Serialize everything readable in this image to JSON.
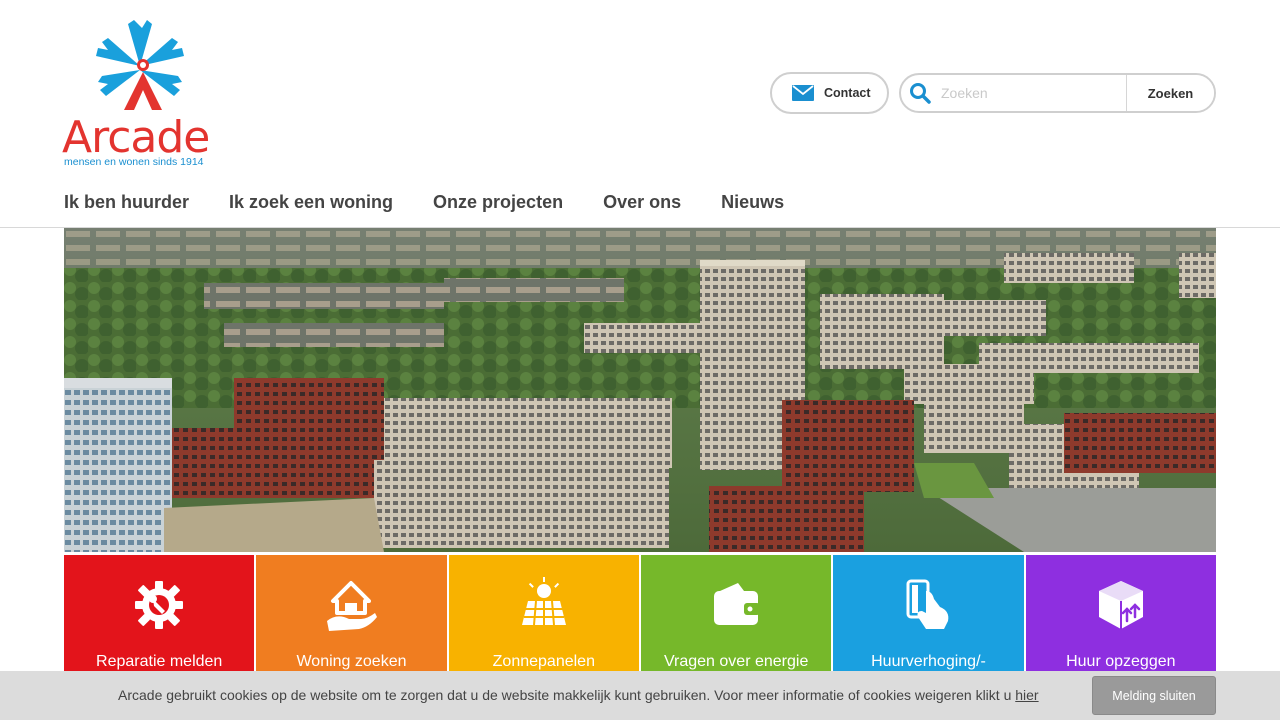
{
  "logo": {
    "word": "Arcade",
    "tagline": "mensen en wonen sinds 1914",
    "colors": {
      "figure_blue": "#1aa0dc",
      "figure_red": "#e3342f"
    }
  },
  "header": {
    "contact": {
      "label": "Contact",
      "icon": "envelope-icon"
    },
    "search": {
      "placeholder": "Zoeken",
      "value": "",
      "button_label": "Zoeken",
      "icon": "search-icon"
    }
  },
  "nav": {
    "items": [
      {
        "label": "Ik ben huurder"
      },
      {
        "label": "Ik zoek een woning"
      },
      {
        "label": "Onze projecten"
      },
      {
        "label": "Over ons"
      },
      {
        "label": "Nieuws"
      }
    ]
  },
  "tiles": [
    {
      "label": "Reparatie melden",
      "color": "#e3141b",
      "icon": "wrench-gear-icon"
    },
    {
      "label": "Woning zoeken",
      "color": "#f07d20",
      "icon": "house-in-hand-icon"
    },
    {
      "label": "Zonnepanelen",
      "color": "#f8b200",
      "icon": "solar-panel-icon"
    },
    {
      "label": "Vragen over energie",
      "color": "#76b82a",
      "icon": "wallet-icon"
    },
    {
      "label": "Huurverhoging/-",
      "color": "#1aa0e0",
      "icon": "card-payment-icon"
    },
    {
      "label": "Huur opzeggen",
      "color": "#8e2fe0",
      "icon": "moving-box-icon"
    }
  ],
  "cookie": {
    "text": "Arcade gebruikt cookies op de website om te zorgen dat u de website makkelijk kunt gebruiken. Voor meer informatie of cookies weigeren klikt u",
    "link_label": "hier",
    "button_label": "Melding sluiten"
  }
}
